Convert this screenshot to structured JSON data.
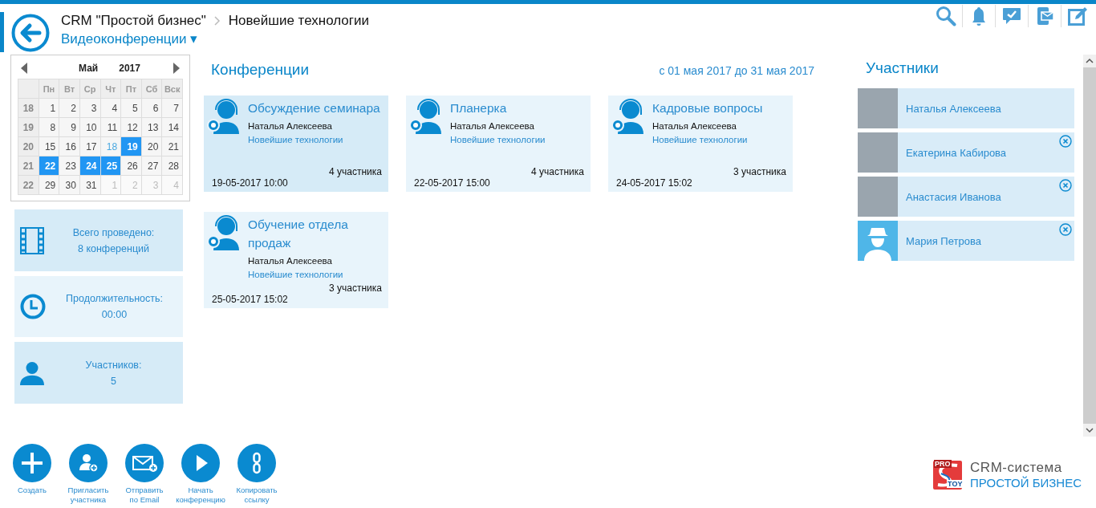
{
  "header": {
    "breadcrumb": [
      "CRM \"Простой бизнес\"",
      "Новейшие технологии"
    ],
    "section": "Видеоконференции",
    "caret": "▾"
  },
  "calendar": {
    "month": "Май",
    "year": "2017",
    "weekdays": [
      "Пн",
      "Вт",
      "Ср",
      "Чт",
      "Пт",
      "Сб",
      "Вск"
    ],
    "weeks": [
      {
        "number": "18",
        "days": [
          {
            "label": "1",
            "kind": "normal",
            "selected": false
          },
          {
            "label": "2",
            "kind": "normal",
            "selected": false
          },
          {
            "label": "3",
            "kind": "normal",
            "selected": false
          },
          {
            "label": "4",
            "kind": "normal",
            "selected": false
          },
          {
            "label": "5",
            "kind": "normal",
            "selected": false
          },
          {
            "label": "6",
            "kind": "normal",
            "selected": false
          },
          {
            "label": "7",
            "kind": "normal",
            "selected": false
          }
        ]
      },
      {
        "number": "19",
        "days": [
          {
            "label": "8",
            "kind": "normal",
            "selected": false
          },
          {
            "label": "9",
            "kind": "normal",
            "selected": false
          },
          {
            "label": "10",
            "kind": "normal",
            "selected": false
          },
          {
            "label": "11",
            "kind": "normal",
            "selected": false
          },
          {
            "label": "12",
            "kind": "normal",
            "selected": false
          },
          {
            "label": "13",
            "kind": "normal",
            "selected": false
          },
          {
            "label": "14",
            "kind": "normal",
            "selected": false
          }
        ]
      },
      {
        "number": "20",
        "days": [
          {
            "label": "15",
            "kind": "normal",
            "selected": false
          },
          {
            "label": "16",
            "kind": "normal",
            "selected": false
          },
          {
            "label": "17",
            "kind": "normal",
            "selected": false
          },
          {
            "label": "18",
            "kind": "today",
            "selected": false
          },
          {
            "label": "19",
            "kind": "normal",
            "selected": true
          },
          {
            "label": "20",
            "kind": "normal",
            "selected": false
          },
          {
            "label": "21",
            "kind": "normal",
            "selected": false
          }
        ]
      },
      {
        "number": "21",
        "days": [
          {
            "label": "22",
            "kind": "normal",
            "selected": true
          },
          {
            "label": "23",
            "kind": "normal",
            "selected": false
          },
          {
            "label": "24",
            "kind": "normal",
            "selected": true
          },
          {
            "label": "25",
            "kind": "normal",
            "selected": true
          },
          {
            "label": "26",
            "kind": "normal",
            "selected": false
          },
          {
            "label": "27",
            "kind": "normal",
            "selected": false
          },
          {
            "label": "28",
            "kind": "normal",
            "selected": false
          }
        ]
      },
      {
        "number": "22",
        "days": [
          {
            "label": "29",
            "kind": "normal",
            "selected": false
          },
          {
            "label": "30",
            "kind": "normal",
            "selected": false
          },
          {
            "label": "31",
            "kind": "normal",
            "selected": false
          },
          {
            "label": "1",
            "kind": "other",
            "selected": false
          },
          {
            "label": "2",
            "kind": "other",
            "selected": false
          },
          {
            "label": "3",
            "kind": "other",
            "selected": false
          },
          {
            "label": "4",
            "kind": "other",
            "selected": false
          }
        ]
      }
    ]
  },
  "stats": [
    {
      "kind": "film",
      "label": "Всего проведено:",
      "value": "8 конференций"
    },
    {
      "kind": "clock",
      "label": "Продолжительность:",
      "value": "00:00"
    },
    {
      "kind": "person",
      "label": "Участников:",
      "value": "5"
    }
  ],
  "conferences": {
    "title": "Конференции",
    "period": "с 01 мая 2017 до 31 мая 2017",
    "items": [
      {
        "title": "Обсуждение семинара",
        "author": "Наталья Алексеева",
        "project": "Новейшие технологии",
        "participants": "4 участника",
        "date": "19-05-2017 10:00",
        "selected": true
      },
      {
        "title": "Планерка",
        "author": "Наталья Алексеева",
        "project": "Новейшие технологии",
        "participants": "4 участника",
        "date": "22-05-2017 15:00",
        "selected": false
      },
      {
        "title": "Кадровые вопросы",
        "author": "Наталья Алексеева",
        "project": "Новейшие технологии",
        "participants": "3 участника",
        "date": "24-05-2017 15:02",
        "selected": false
      },
      {
        "title": "Обучение отдела продаж",
        "author": "Наталья Алексеева",
        "project": "Новейшие технологии",
        "participants": "3 участника",
        "date": "25-05-2017 15:02",
        "selected": false
      }
    ]
  },
  "participants": {
    "title": "Участники",
    "items": [
      {
        "name": "Наталья Алексеева",
        "kind": "photo",
        "removable": false
      },
      {
        "name": "Екатерина Кабирова",
        "kind": "photo",
        "removable": true
      },
      {
        "name": "Анастасия Иванова",
        "kind": "photo",
        "removable": true
      },
      {
        "name": "Мария Петрова",
        "kind": "silhouette",
        "removable": true
      }
    ]
  },
  "actions": [
    {
      "kind": "create",
      "label": "Создать"
    },
    {
      "kind": "invite",
      "label": "Пригласить участника"
    },
    {
      "kind": "email",
      "label": "Отправить по Email"
    },
    {
      "kind": "start",
      "label": "Начать конференцию"
    },
    {
      "kind": "link",
      "label": "Копировать ссылку"
    }
  ],
  "logo": {
    "badge_top": "PRO",
    "badge_bottom": "TOY",
    "line1": "CRM-система",
    "line2": "ПРОСТОЙ БИЗНЕС"
  }
}
